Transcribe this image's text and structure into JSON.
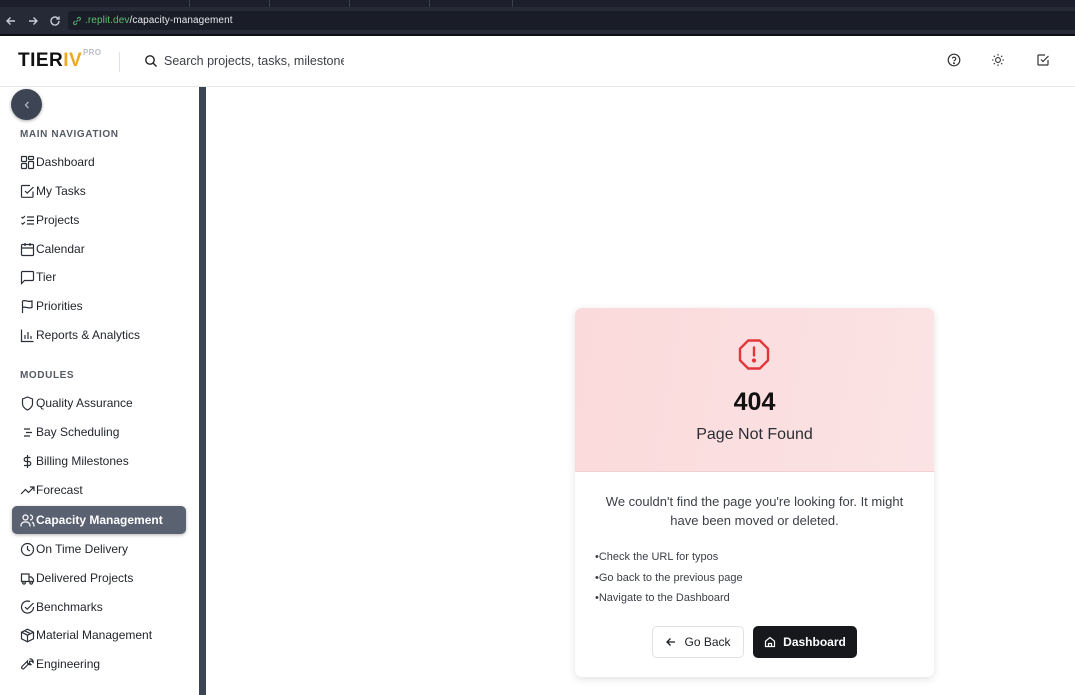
{
  "browser": {
    "url_domain": ".replit.dev",
    "url_path": "/capacity-management"
  },
  "header": {
    "logo_main": "TIER",
    "logo_accent": "IV",
    "logo_badge": "PRO",
    "search_placeholder": "Search projects, tasks, milestones"
  },
  "sidebar": {
    "main_title": "MAIN NAVIGATION",
    "main_items": [
      {
        "label": "Dashboard",
        "icon": "layout-grid-icon"
      },
      {
        "label": "My Tasks",
        "icon": "check-square-icon"
      },
      {
        "label": "Projects",
        "icon": "list-checks-icon"
      },
      {
        "label": "Calendar",
        "icon": "calendar-icon"
      },
      {
        "label": "Tier",
        "icon": "message-square-icon"
      },
      {
        "label": "Priorities",
        "icon": "flag-icon"
      },
      {
        "label": "Reports & Analytics",
        "icon": "bar-chart-icon"
      }
    ],
    "modules_title": "MODULES",
    "module_items": [
      {
        "label": "Quality Assurance",
        "icon": "shield-icon"
      },
      {
        "label": "Bay Scheduling",
        "icon": "align-list-icon"
      },
      {
        "label": "Billing Milestones",
        "icon": "dollar-icon"
      },
      {
        "label": "Forecast",
        "icon": "trending-up-icon"
      },
      {
        "label": "Capacity Management",
        "icon": "users-icon",
        "active": true
      },
      {
        "label": "On Time Delivery",
        "icon": "clock-icon"
      },
      {
        "label": "Delivered Projects",
        "icon": "truck-icon"
      },
      {
        "label": "Benchmarks",
        "icon": "check-circle-icon"
      },
      {
        "label": "Material Management",
        "icon": "package-icon"
      },
      {
        "label": "Engineering",
        "icon": "wrench-icon"
      }
    ]
  },
  "error_card": {
    "code": "404",
    "title": "Page Not Found",
    "message": "We couldn't find the page you're looking for. It might have been moved or deleted.",
    "tips": [
      "Check the URL for typos",
      "Go back to the previous page",
      "Navigate to the Dashboard"
    ],
    "go_back_label": "Go Back",
    "dashboard_label": "Dashboard"
  },
  "colors": {
    "accent": "#f0a81c",
    "error": "#e2363b",
    "active_nav": "#5a6271",
    "primary_button": "#16181c"
  }
}
